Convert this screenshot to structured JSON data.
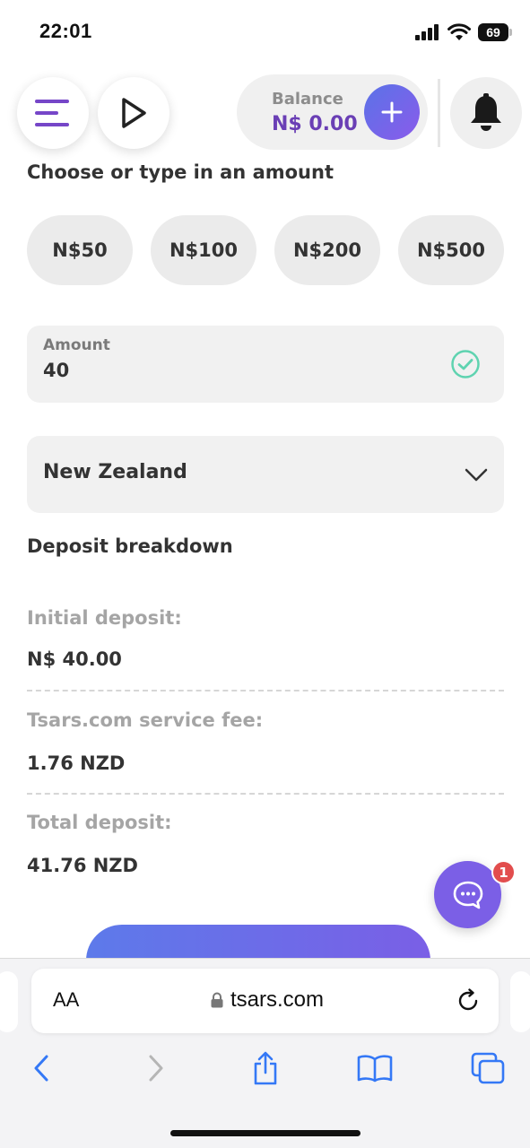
{
  "status_bar": {
    "time": "22:01",
    "battery": "69"
  },
  "header": {
    "balance_label": "Balance",
    "balance_value": "N$ 0.00",
    "accent_color": "#7b5fe6"
  },
  "deposit": {
    "choose_title": "Choose or type in an amount",
    "presets": [
      "N$50",
      "N$100",
      "N$200",
      "N$500"
    ],
    "amount_label": "Amount",
    "amount_value": "40",
    "country_value": "New Zealand",
    "breakdown_title": "Deposit breakdown",
    "initial_label": "Initial deposit:",
    "initial_value": "N$ 40.00",
    "fee_label": "Tsars.com service fee:",
    "fee_value": "1.76 NZD",
    "total_label": "Total deposit:",
    "total_value": "41.76 NZD"
  },
  "chat": {
    "badge_count": "1"
  },
  "browser": {
    "aa_label": "AA",
    "url": "tsars.com"
  },
  "icons": {
    "menu": "hamburger-icon",
    "play": "play-icon",
    "add": "plus-icon",
    "notifications": "bell-icon",
    "amount_valid": "check-circle-icon",
    "country_dropdown": "chevron-down-icon",
    "chat": "chat-bubble-icon",
    "browser_back": "chevron-left-icon",
    "browser_forward": "chevron-right-icon",
    "share": "share-icon",
    "bookmarks": "book-icon",
    "tabs": "tabs-icon"
  }
}
